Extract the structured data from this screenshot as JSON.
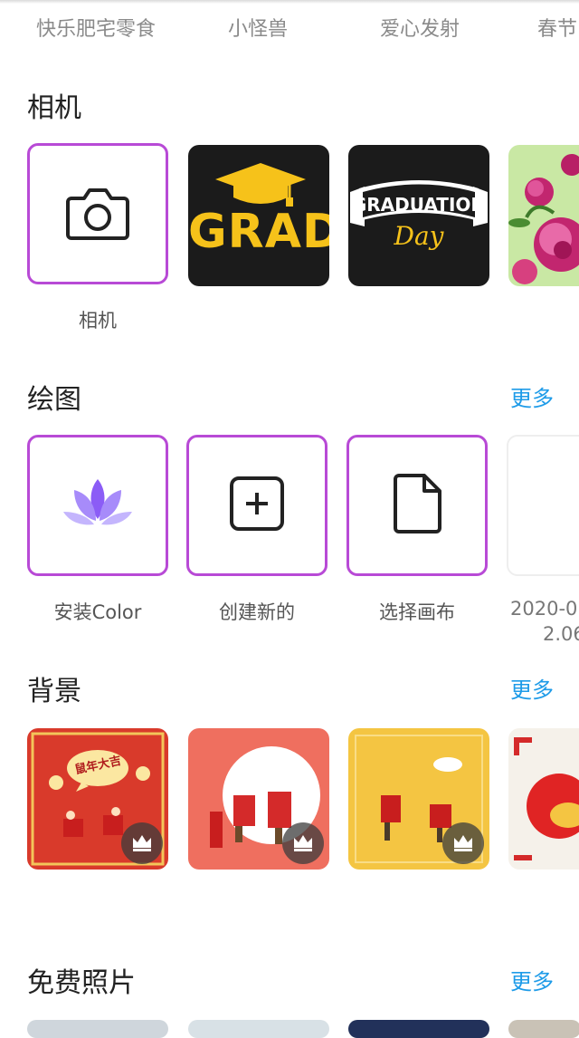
{
  "tabs": [
    "快乐肥宅零食",
    "小怪兽",
    "爱心发射",
    "春节"
  ],
  "camera": {
    "title": "相机",
    "camera_label": "相机",
    "grad_text": "GRAD",
    "graduation_text": "GRADUATION",
    "day_text": "Day"
  },
  "drawing": {
    "title": "绘图",
    "more": "更多",
    "items": [
      "安装Color",
      "创建新的",
      "选择画布"
    ],
    "partial_date": "2020-0",
    "partial_size": "2.06"
  },
  "backgrounds": {
    "title": "背景",
    "more": "更多",
    "sign_text": "鼠年大吉"
  },
  "free_photos": {
    "title": "免费照片",
    "more": "更多"
  },
  "colors": {
    "accent_border": "#b84ad6",
    "link": "#1e9be8",
    "grad_yellow": "#f6c21a"
  }
}
